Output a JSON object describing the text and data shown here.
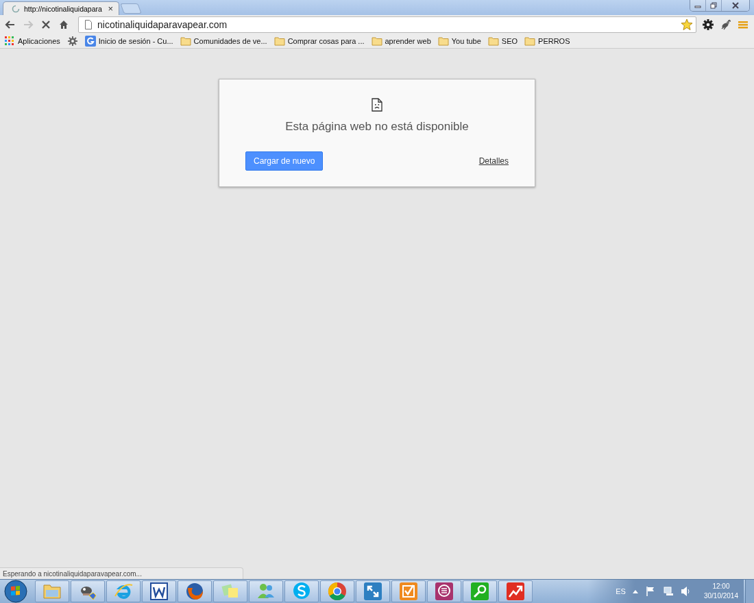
{
  "tabs": [
    {
      "title": "http://nicotinaliquidapara",
      "selected": true,
      "loading": true,
      "close": "×"
    }
  ],
  "nav": [
    {
      "kind": "back",
      "disabled": false
    },
    {
      "kind": "forward",
      "disabled": true
    },
    {
      "kind": "stop",
      "disabled": false
    },
    {
      "kind": "home",
      "disabled": false
    }
  ],
  "address": {
    "value": "nicotinaliquidaparavapear.com",
    "starred": true
  },
  "bookmarks": [
    {
      "kind": "apps",
      "label": "Aplicaciones"
    },
    {
      "kind": "gear"
    },
    {
      "kind": "google",
      "label": "Inicio de sesión - Cu..."
    },
    {
      "kind": "folder",
      "label": "Comunidades de ve..."
    },
    {
      "kind": "folder",
      "label": "Comprar cosas para ..."
    },
    {
      "kind": "folder",
      "label": "aprender web"
    },
    {
      "kind": "folder",
      "label": "You tube"
    },
    {
      "kind": "folder",
      "label": "SEO"
    },
    {
      "kind": "folder",
      "label": "PERROS"
    }
  ],
  "error_card": {
    "title": "Esta página web no está disponible",
    "reload_button": "Cargar de nuevo",
    "details_link": "Detalles"
  },
  "status_bubble": "Esperando a nicotinaliquidaparavapear.com...",
  "taskbar": {
    "apps": [
      {
        "kind": "folder"
      },
      {
        "kind": "mascot"
      },
      {
        "kind": "ie"
      },
      {
        "kind": "word"
      },
      {
        "kind": "firefox"
      },
      {
        "kind": "notes"
      },
      {
        "kind": "people"
      },
      {
        "kind": "skype"
      },
      {
        "kind": "chrome"
      },
      {
        "kind": "remote"
      },
      {
        "kind": "tasks"
      },
      {
        "kind": "chat"
      },
      {
        "kind": "search"
      },
      {
        "kind": "chart"
      }
    ],
    "language": "ES",
    "time": "12:00",
    "date": "30/10/2014"
  }
}
